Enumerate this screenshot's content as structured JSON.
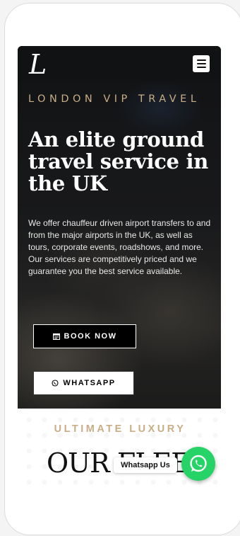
{
  "header": {
    "logo_glyph": "L",
    "menu_icon": "hamburger-icon"
  },
  "hero": {
    "eyebrow": "LONDON VIP TRAVEL",
    "headline": "An elite ground travel service in the UK",
    "description": "We offer chauffeur driven airport transfers to and from the major airports in the UK, as well as tours, corporate events, roadshows, and more. Our services are competitively priced and we guarantee you the best service available.",
    "book_button_label": "BOOK NOW",
    "book_button_icon": "calendar-icon",
    "whatsapp_button_label": "WHATSAPP",
    "whatsapp_button_icon": "whatsapp-icon"
  },
  "fleet": {
    "eyebrow": "ULTIMATE LUXURY",
    "title": "OUR FLEET"
  },
  "floating_chat": {
    "label": "Whatsapp Us",
    "icon": "whatsapp-icon",
    "color": "#25d366"
  },
  "colors": {
    "accent_gold": "#c8ad86",
    "nav_bg": "#111214",
    "whatsapp_green": "#25d366"
  }
}
